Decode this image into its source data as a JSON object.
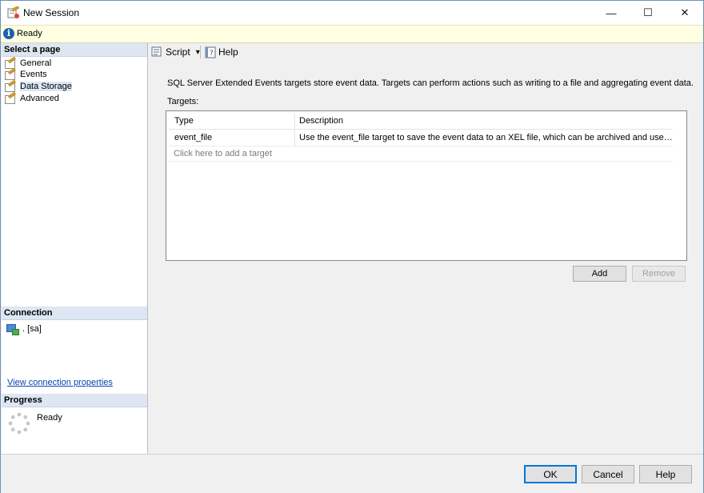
{
  "window": {
    "title": "New Session",
    "controls": {
      "minimize": "—",
      "maximize": "☐",
      "close": "✕"
    }
  },
  "status": {
    "text": "Ready"
  },
  "left_panel": {
    "select_page_header": "Select a page",
    "pages": [
      {
        "label": "General",
        "selected": false
      },
      {
        "label": "Events",
        "selected": false
      },
      {
        "label": "Data Storage",
        "selected": true
      },
      {
        "label": "Advanced",
        "selected": false
      }
    ],
    "connection_header": "Connection",
    "connection_value": ". [sa]",
    "view_connection_link": "View connection properties",
    "progress_header": "Progress",
    "progress_status": "Ready"
  },
  "toolbar": {
    "script_label": "Script",
    "script_dropdown": "▾",
    "help_label": "Help"
  },
  "main": {
    "description": "SQL Server Extended Events targets store event data. Targets can perform actions such as writing to a file and aggregating event data.",
    "targets_label": "Targets:",
    "grid": {
      "columns": [
        "Type",
        "Description"
      ],
      "rows": [
        {
          "type": "event_file",
          "description": "Use the event_file target to save the event data to an XEL file, which can be archived and used for later an..."
        }
      ],
      "add_placeholder": "Click here to add a target"
    },
    "add_button": "Add",
    "remove_button": "Remove"
  },
  "footer": {
    "ok": "OK",
    "cancel": "Cancel",
    "help": "Help"
  },
  "colors": {
    "status_bar": "#ffffe1",
    "section_header": "#dde6f2",
    "link": "#0645ad",
    "default_button_border": "#0078d7"
  }
}
